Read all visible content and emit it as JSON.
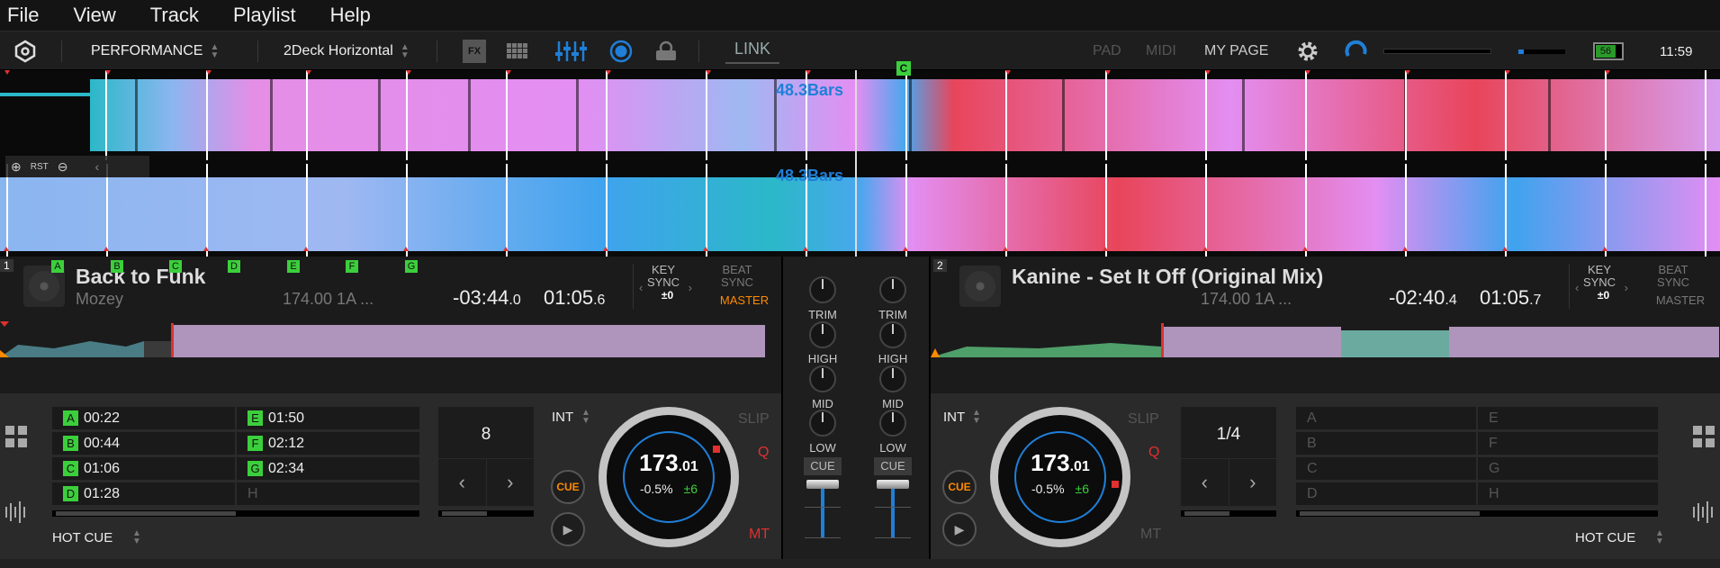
{
  "menu": [
    "File",
    "View",
    "Track",
    "Playlist",
    "Help"
  ],
  "toolbar": {
    "mode": "PERFORMANCE",
    "layout": "2Deck Horizontal",
    "fx_label": "FX",
    "link_label": "LINK",
    "pad_label": "PAD",
    "midi_label": "MIDI",
    "mypage_label": "MY PAGE",
    "battery": "56",
    "clock": "11:59"
  },
  "waveform": {
    "bars_top": "48.3Bars",
    "bars_bottom": "48.3Bars",
    "rst_label": "RST",
    "cue_marker": "C"
  },
  "deck1": {
    "number": "1",
    "title": "Back to Funk",
    "artist": "Mozey",
    "bpm_key": "174.00 1A ...",
    "remaining": "-03:44",
    "remaining_frac": ".0",
    "elapsed": "01:05",
    "elapsed_frac": ".6",
    "key_sync_label": "KEY SYNC",
    "key_sync_value": "±0",
    "beat_sync_label": "BEAT SYNC",
    "master_label": "MASTER",
    "overview_cues": [
      "A",
      "B",
      "C",
      "D",
      "E",
      "F",
      "G"
    ],
    "hot_cues": [
      {
        "tag": "A",
        "time": "00:22"
      },
      {
        "tag": "E",
        "time": "01:50"
      },
      {
        "tag": "B",
        "time": "00:44"
      },
      {
        "tag": "F",
        "time": "02:12"
      },
      {
        "tag": "C",
        "time": "01:06"
      },
      {
        "tag": "G",
        "time": "02:34"
      },
      {
        "tag": "D",
        "time": "01:28"
      },
      {
        "tag": "",
        "time": "H"
      }
    ],
    "pad_mode": "HOT CUE",
    "loop_value": "8",
    "int_label": "INT",
    "cue_label": "CUE",
    "bpm_whole": "173",
    "bpm_frac": ".01",
    "pitch": "-0.5%",
    "pitch_range": "±6",
    "slip": "SLIP",
    "q": "Q",
    "mt": "MT"
  },
  "deck2": {
    "number": "2",
    "title": "Kanine - Set It Off (Original Mix)",
    "bpm_key": "174.00 1A ...",
    "remaining": "-02:40",
    "remaining_frac": ".4",
    "elapsed": "01:05",
    "elapsed_frac": ".7",
    "key_sync_label": "KEY SYNC",
    "key_sync_value": "±0",
    "beat_sync_label": "BEAT SYNC",
    "master_label": "MASTER",
    "hot_cues": [
      "A",
      "E",
      "B",
      "F",
      "C",
      "G",
      "D",
      "H"
    ],
    "pad_mode": "HOT CUE",
    "loop_value": "1/4",
    "int_label": "INT",
    "cue_label": "CUE",
    "bpm_whole": "173",
    "bpm_frac": ".01",
    "pitch": "-0.5%",
    "pitch_range": "±6",
    "slip": "SLIP",
    "q": "Q",
    "mt": "MT"
  },
  "mixer": {
    "trim": "TRIM",
    "high": "HIGH",
    "mid": "MID",
    "low": "LOW",
    "cue": "CUE"
  },
  "colors": {
    "accent_blue": "#1f7fd8",
    "hotcue_green": "#3ccf3c",
    "master_orange": "#ff8a00",
    "alert_red": "#e03030"
  }
}
